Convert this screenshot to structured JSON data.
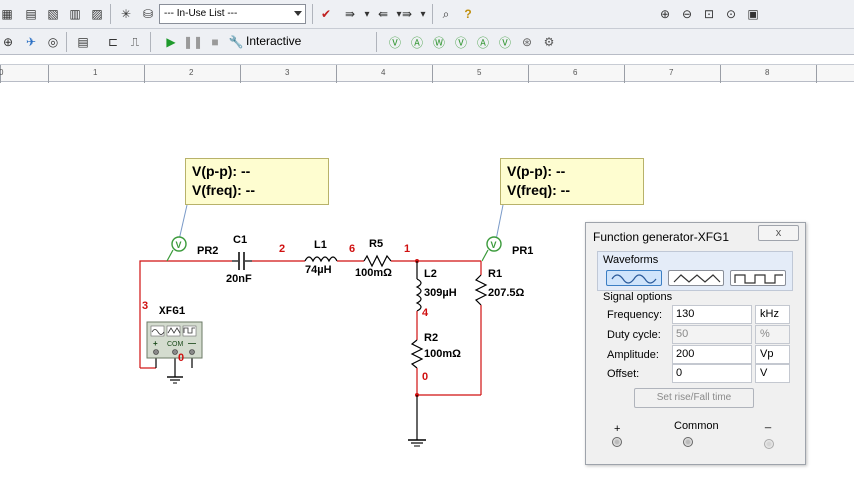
{
  "toolbar": {
    "in_use_list": "--- In-Use List ---",
    "interactive_label": "Interactive"
  },
  "ruler": {
    "numbers": [
      "0",
      "1",
      "2",
      "3",
      "4",
      "5",
      "6",
      "7",
      "8"
    ]
  },
  "probes": {
    "left": {
      "vpp": "V(p-p): --",
      "vfreq": "V(freq): --",
      "name": "PR2"
    },
    "right": {
      "vpp": "V(p-p): --",
      "vfreq": "V(freq): --",
      "name": "PR1"
    }
  },
  "components": {
    "c1": {
      "name": "C1",
      "value": "20nF"
    },
    "l1": {
      "name": "L1",
      "value": "74µH"
    },
    "r5": {
      "name": "R5",
      "value": "100mΩ"
    },
    "l2": {
      "name": "L2",
      "value": "309µH"
    },
    "r1": {
      "name": "R1",
      "value": "207.5Ω"
    },
    "r2": {
      "name": "R2",
      "value": "100mΩ"
    },
    "xfg1": {
      "name": "XFG1",
      "com": "COM",
      "plus": "+",
      "minus": "—"
    }
  },
  "nodes": {
    "n1": "1",
    "n2": "2",
    "n3": "3",
    "n4": "4",
    "n6": "6",
    "n0a": "0",
    "n0b": "0"
  },
  "function_generator": {
    "title": "Function generator-XFG1",
    "close_label": "x",
    "waveforms_label": "Waveforms",
    "signal_options_label": "Signal options",
    "rows": [
      {
        "label": "Frequency:",
        "value": "130",
        "unit": "kHz",
        "disabled": false
      },
      {
        "label": "Duty cycle:",
        "value": "50",
        "unit": "%",
        "disabled": true
      },
      {
        "label": "Amplitude:",
        "value": "200",
        "unit": "Vp",
        "disabled": false
      },
      {
        "label": "Offset:",
        "value": "0",
        "unit": "V",
        "disabled": false
      }
    ],
    "set_rise_fall": "Set rise/Fall time",
    "plus_label": "+",
    "common_label": "Common",
    "minus_label": "_"
  },
  "colors": {
    "wire": "#d01010",
    "ground": "#000000",
    "probe_fill": "#fefdd0",
    "probe_icon": "#3a9a3a"
  }
}
